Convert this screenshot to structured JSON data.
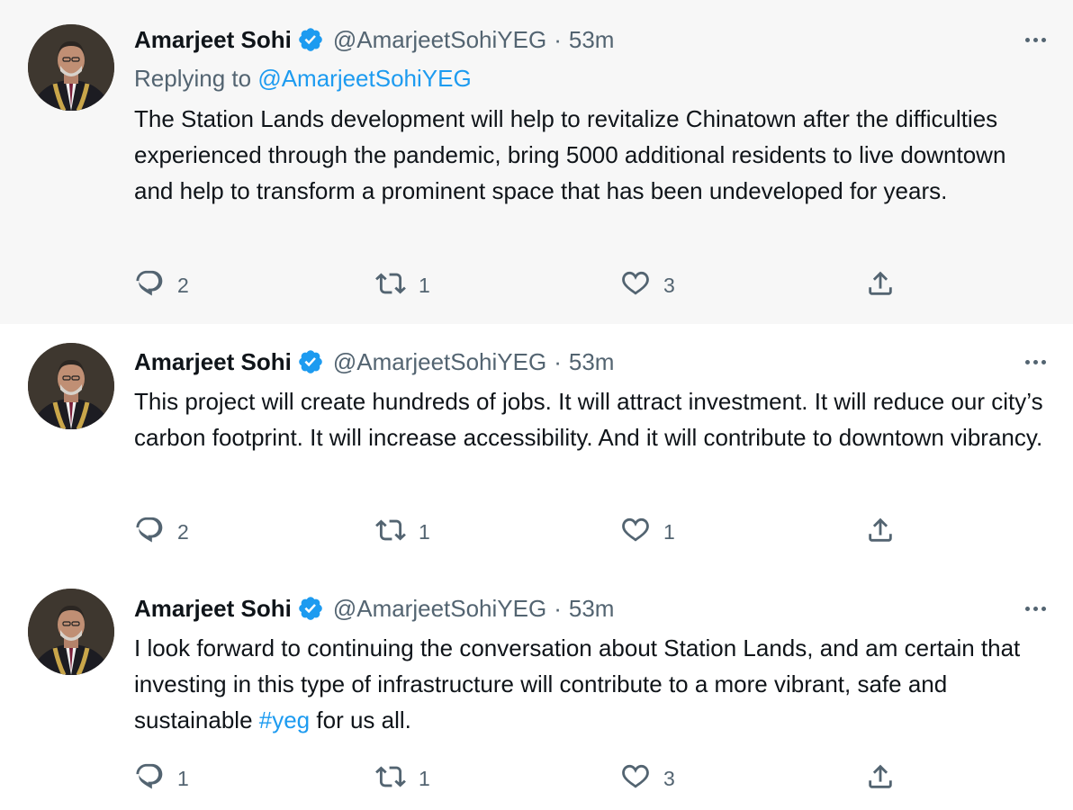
{
  "colors": {
    "link": "#1d9bf0",
    "verified": "#1d9bf0",
    "secondary_text": "#536471",
    "primary_text": "#0f1419",
    "thread_line": "#cfd9de",
    "highlight_bg": "#f7f7f7"
  },
  "tweets": [
    {
      "author_name": "Amarjeet Sohi",
      "handle": "@AmarjeetSohiYEG",
      "separator": "·",
      "time": "53m",
      "reply_label": "Replying to",
      "reply_handle": "@AmarjeetSohiYEG",
      "text": "The Station Lands development will help to revitalize Chinatown after the difficulties experienced through the pandemic, bring 5000 additional residents to live downtown and help to transform a prominent space that has been undeveloped for years.",
      "replies": "2",
      "retweets": "1",
      "likes": "3"
    },
    {
      "author_name": "Amarjeet Sohi",
      "handle": "@AmarjeetSohiYEG",
      "separator": "·",
      "time": "53m",
      "text": "This project will create hundreds of jobs. It will attract investment. It will reduce our city’s carbon footprint. It will increase accessibility. And it will contribute to downtown vibrancy.",
      "replies": "2",
      "retweets": "1",
      "likes": "1"
    },
    {
      "author_name": "Amarjeet Sohi",
      "handle": "@AmarjeetSohiYEG",
      "separator": "·",
      "time": "53m",
      "text_before": "I look forward to continuing the conversation about Station Lands, and am certain that investing in this type of infrastructure will contribute to a more vibrant, safe and sustainable ",
      "hashtag": "#yeg",
      "text_after": " for us all.",
      "replies": "1",
      "retweets": "1",
      "likes": "3"
    }
  ],
  "icons": {
    "verified": "verified-badge-icon",
    "more": "more-options-icon",
    "reply": "reply-icon",
    "retweet": "retweet-icon",
    "like": "heart-icon",
    "share": "share-icon"
  }
}
